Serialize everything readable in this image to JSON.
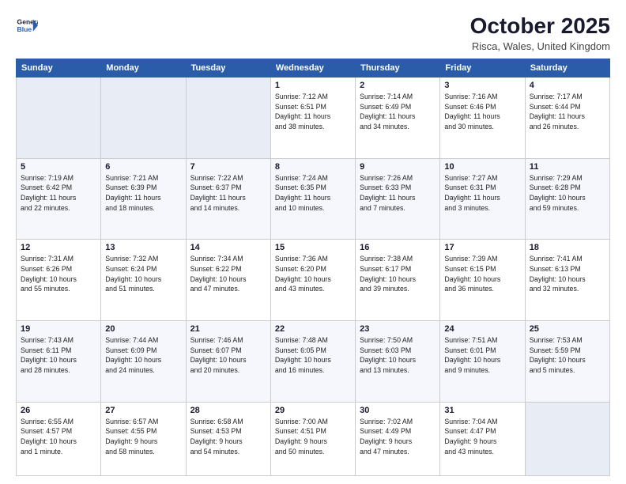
{
  "header": {
    "logo_line1": "General",
    "logo_line2": "Blue",
    "title": "October 2025",
    "location": "Risca, Wales, United Kingdom"
  },
  "weekdays": [
    "Sunday",
    "Monday",
    "Tuesday",
    "Wednesday",
    "Thursday",
    "Friday",
    "Saturday"
  ],
  "weeks": [
    [
      {
        "day": "",
        "info": ""
      },
      {
        "day": "",
        "info": ""
      },
      {
        "day": "",
        "info": ""
      },
      {
        "day": "1",
        "info": "Sunrise: 7:12 AM\nSunset: 6:51 PM\nDaylight: 11 hours\nand 38 minutes."
      },
      {
        "day": "2",
        "info": "Sunrise: 7:14 AM\nSunset: 6:49 PM\nDaylight: 11 hours\nand 34 minutes."
      },
      {
        "day": "3",
        "info": "Sunrise: 7:16 AM\nSunset: 6:46 PM\nDaylight: 11 hours\nand 30 minutes."
      },
      {
        "day": "4",
        "info": "Sunrise: 7:17 AM\nSunset: 6:44 PM\nDaylight: 11 hours\nand 26 minutes."
      }
    ],
    [
      {
        "day": "5",
        "info": "Sunrise: 7:19 AM\nSunset: 6:42 PM\nDaylight: 11 hours\nand 22 minutes."
      },
      {
        "day": "6",
        "info": "Sunrise: 7:21 AM\nSunset: 6:39 PM\nDaylight: 11 hours\nand 18 minutes."
      },
      {
        "day": "7",
        "info": "Sunrise: 7:22 AM\nSunset: 6:37 PM\nDaylight: 11 hours\nand 14 minutes."
      },
      {
        "day": "8",
        "info": "Sunrise: 7:24 AM\nSunset: 6:35 PM\nDaylight: 11 hours\nand 10 minutes."
      },
      {
        "day": "9",
        "info": "Sunrise: 7:26 AM\nSunset: 6:33 PM\nDaylight: 11 hours\nand 7 minutes."
      },
      {
        "day": "10",
        "info": "Sunrise: 7:27 AM\nSunset: 6:31 PM\nDaylight: 11 hours\nand 3 minutes."
      },
      {
        "day": "11",
        "info": "Sunrise: 7:29 AM\nSunset: 6:28 PM\nDaylight: 10 hours\nand 59 minutes."
      }
    ],
    [
      {
        "day": "12",
        "info": "Sunrise: 7:31 AM\nSunset: 6:26 PM\nDaylight: 10 hours\nand 55 minutes."
      },
      {
        "day": "13",
        "info": "Sunrise: 7:32 AM\nSunset: 6:24 PM\nDaylight: 10 hours\nand 51 minutes."
      },
      {
        "day": "14",
        "info": "Sunrise: 7:34 AM\nSunset: 6:22 PM\nDaylight: 10 hours\nand 47 minutes."
      },
      {
        "day": "15",
        "info": "Sunrise: 7:36 AM\nSunset: 6:20 PM\nDaylight: 10 hours\nand 43 minutes."
      },
      {
        "day": "16",
        "info": "Sunrise: 7:38 AM\nSunset: 6:17 PM\nDaylight: 10 hours\nand 39 minutes."
      },
      {
        "day": "17",
        "info": "Sunrise: 7:39 AM\nSunset: 6:15 PM\nDaylight: 10 hours\nand 36 minutes."
      },
      {
        "day": "18",
        "info": "Sunrise: 7:41 AM\nSunset: 6:13 PM\nDaylight: 10 hours\nand 32 minutes."
      }
    ],
    [
      {
        "day": "19",
        "info": "Sunrise: 7:43 AM\nSunset: 6:11 PM\nDaylight: 10 hours\nand 28 minutes."
      },
      {
        "day": "20",
        "info": "Sunrise: 7:44 AM\nSunset: 6:09 PM\nDaylight: 10 hours\nand 24 minutes."
      },
      {
        "day": "21",
        "info": "Sunrise: 7:46 AM\nSunset: 6:07 PM\nDaylight: 10 hours\nand 20 minutes."
      },
      {
        "day": "22",
        "info": "Sunrise: 7:48 AM\nSunset: 6:05 PM\nDaylight: 10 hours\nand 16 minutes."
      },
      {
        "day": "23",
        "info": "Sunrise: 7:50 AM\nSunset: 6:03 PM\nDaylight: 10 hours\nand 13 minutes."
      },
      {
        "day": "24",
        "info": "Sunrise: 7:51 AM\nSunset: 6:01 PM\nDaylight: 10 hours\nand 9 minutes."
      },
      {
        "day": "25",
        "info": "Sunrise: 7:53 AM\nSunset: 5:59 PM\nDaylight: 10 hours\nand 5 minutes."
      }
    ],
    [
      {
        "day": "26",
        "info": "Sunrise: 6:55 AM\nSunset: 4:57 PM\nDaylight: 10 hours\nand 1 minute."
      },
      {
        "day": "27",
        "info": "Sunrise: 6:57 AM\nSunset: 4:55 PM\nDaylight: 9 hours\nand 58 minutes."
      },
      {
        "day": "28",
        "info": "Sunrise: 6:58 AM\nSunset: 4:53 PM\nDaylight: 9 hours\nand 54 minutes."
      },
      {
        "day": "29",
        "info": "Sunrise: 7:00 AM\nSunset: 4:51 PM\nDaylight: 9 hours\nand 50 minutes."
      },
      {
        "day": "30",
        "info": "Sunrise: 7:02 AM\nSunset: 4:49 PM\nDaylight: 9 hours\nand 47 minutes."
      },
      {
        "day": "31",
        "info": "Sunrise: 7:04 AM\nSunset: 4:47 PM\nDaylight: 9 hours\nand 43 minutes."
      },
      {
        "day": "",
        "info": ""
      }
    ]
  ]
}
